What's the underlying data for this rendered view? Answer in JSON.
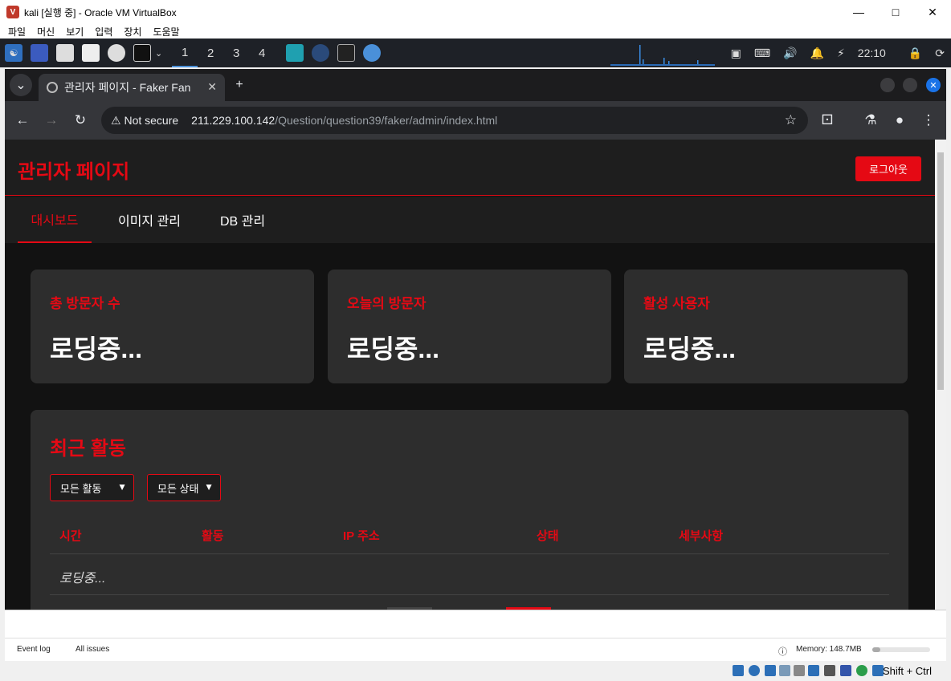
{
  "vbox": {
    "title": "kali [실행 중] - Oracle VM VirtualBox",
    "menu": [
      "파일",
      "머신",
      "보기",
      "입력",
      "장치",
      "도움말"
    ],
    "status_keys": "Shift + Ctrl"
  },
  "panel": {
    "workspaces": [
      "1",
      "2",
      "3",
      "4"
    ],
    "clock": "22:10"
  },
  "browser": {
    "tab_title": "관리자 페이지 - Faker Fan",
    "security_label": "Not secure",
    "url_host": "211.229.100.142",
    "url_path": "/Question/question39/faker/admin/index.html"
  },
  "page": {
    "title": "관리자 페이지",
    "logout_label": "로그아웃",
    "nav_tabs": [
      "대시보드",
      "이미지 관리",
      "DB 관리"
    ],
    "cards": [
      {
        "label": "총 방문자 수",
        "value": "로딩중..."
      },
      {
        "label": "오늘의 방문자",
        "value": "로딩중..."
      },
      {
        "label": "활성 사용자",
        "value": "로딩중..."
      }
    ],
    "activity": {
      "title": "최근 활동",
      "filter_activity": "모든 활동",
      "filter_status": "모든 상태",
      "columns": [
        "시간",
        "활동",
        "IP 주소",
        "상태",
        "세부사항"
      ],
      "loading": "로딩중..."
    }
  },
  "devtools": {
    "event_log": "Event log",
    "all_issues": "All issues",
    "memory": "Memory: 148.7MB"
  },
  "colors": {
    "accent": "#e50914",
    "card_bg": "#2d2d2d",
    "page_bg": "#121212"
  }
}
